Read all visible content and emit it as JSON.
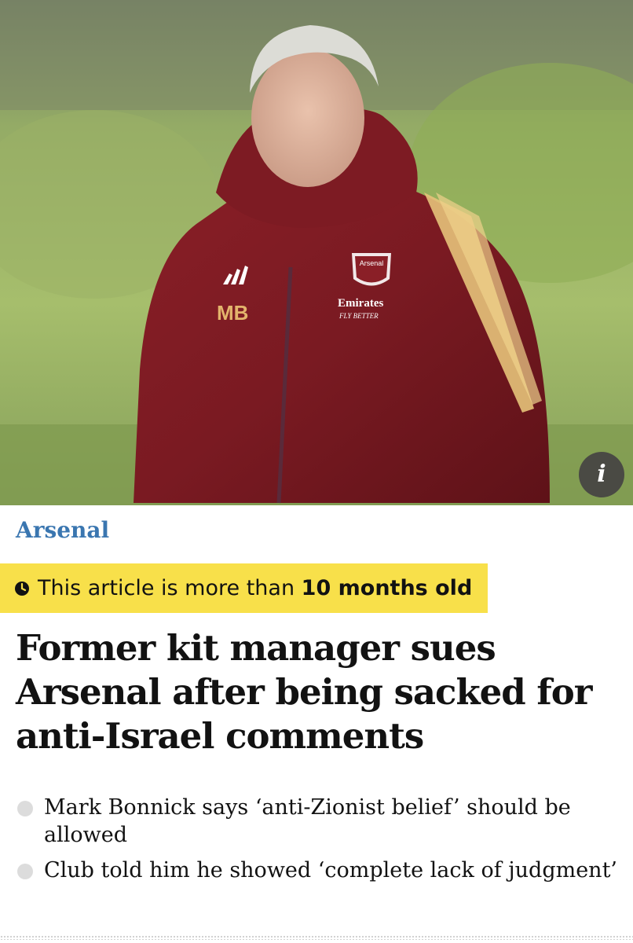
{
  "hero": {
    "photo_alt": "Man in red Arsenal training jacket",
    "jacket_initials": "MB",
    "jacket_crest_text": "Arsenal",
    "jacket_sponsor": "Emirates",
    "jacket_sponsor_tagline": "FLY BETTER",
    "info_button_label": "i"
  },
  "article": {
    "section": "Arsenal",
    "age_warning": {
      "prefix": "This article is more than",
      "age": "10 months old",
      "icon": "clock-icon"
    },
    "headline": "Former kit manager sues Arsenal after being sacked for anti-Israel comments",
    "standfirst": [
      "Mark Bonnick says ‘anti-Zionist belief’ should be allowed",
      "Club told him he showed ‘complete lack of judgment’"
    ]
  },
  "colors": {
    "section_accent": "#3a76b0",
    "age_banner": "#f8e04a",
    "jacket_red": "#7a1c22"
  }
}
